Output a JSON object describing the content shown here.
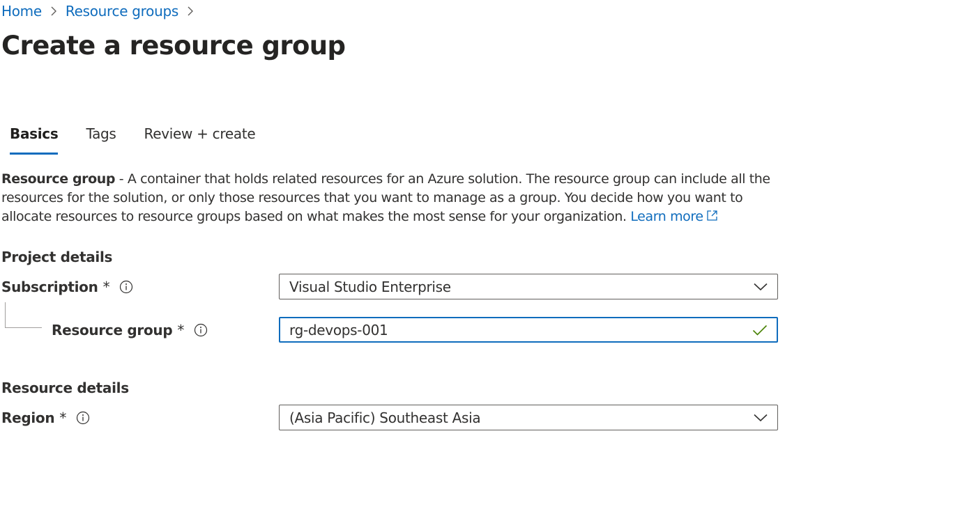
{
  "breadcrumb": {
    "home": "Home",
    "resource_groups": "Resource groups"
  },
  "page_title": "Create a resource group",
  "tabs": [
    {
      "label": "Basics",
      "active": true
    },
    {
      "label": "Tags",
      "active": false
    },
    {
      "label": "Review + create",
      "active": false
    }
  ],
  "description": {
    "lead": "Resource group",
    "body": " - A container that holds related resources for an Azure solution. The resource group can include all the resources for the solution, or only those resources that you want to manage as a group. You decide how you want to allocate resources to resource groups based on what makes the most sense for your organization. ",
    "learn_more": "Learn more"
  },
  "project_details": {
    "title": "Project details",
    "subscription": {
      "label": "Subscription",
      "required_mark": "*",
      "value": "Visual Studio Enterprise"
    },
    "resource_group": {
      "label": "Resource group",
      "required_mark": "*",
      "value": "rg-devops-001",
      "valid": true
    }
  },
  "resource_details": {
    "title": "Resource details",
    "region": {
      "label": "Region",
      "required_mark": "*",
      "value": "(Asia Pacific) Southeast Asia"
    }
  },
  "colors": {
    "link": "#0f6cbd",
    "focus_border": "#0f6cbd",
    "valid_check": "#498205",
    "text": "#323130"
  },
  "icons": {
    "breadcrumb_separator": "chevron-right-icon",
    "external_link": "external-link-icon",
    "info": "info-icon",
    "dropdown": "chevron-down-icon",
    "valid": "checkmark-icon"
  }
}
